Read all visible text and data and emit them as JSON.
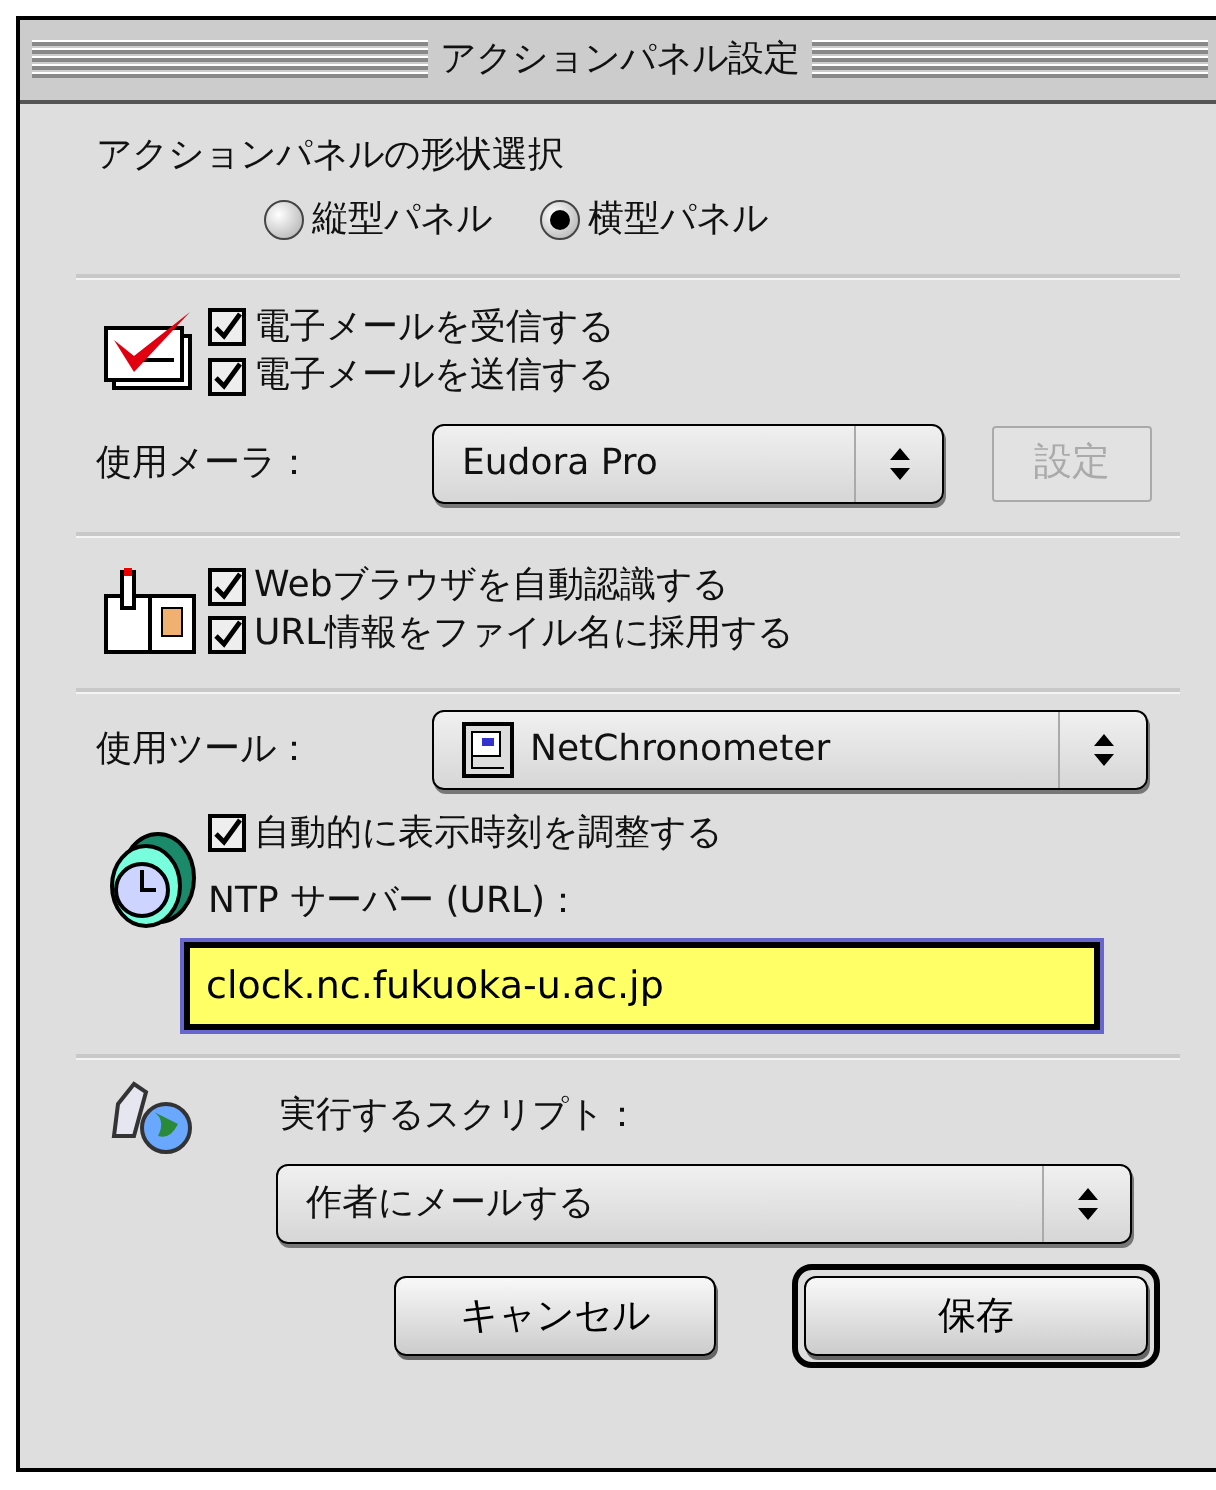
{
  "window": {
    "title": "アクションパネル設定"
  },
  "panel_shape": {
    "label": "アクションパネルの形状選択",
    "options": [
      {
        "label": "縦型パネル",
        "selected": false
      },
      {
        "label": "横型パネル",
        "selected": true
      }
    ]
  },
  "mail": {
    "options": [
      {
        "label": "電子メールを受信する",
        "checked": true
      },
      {
        "label": "電子メールを送信する",
        "checked": true
      }
    ],
    "mailer_label": "使用メーラ：",
    "mailer_value": "Eudora Pro",
    "settings_button": {
      "label": "設定",
      "disabled": true
    }
  },
  "browser": {
    "options": [
      {
        "label": "Webブラウザを自動認識する",
        "checked": true
      },
      {
        "label": "URL情報をファイル名に採用する",
        "checked": true
      }
    ]
  },
  "tool": {
    "label": "使用ツール：",
    "value": "NetChronometer"
  },
  "clock": {
    "option": {
      "label": "自動的に表示時刻を調整する",
      "checked": true
    },
    "ntp_label": "NTP サーバー (URL)：",
    "ntp_value": "clock.nc.fukuoka-u.ac.jp"
  },
  "script": {
    "label": "実行するスクリプト：",
    "value": "作者にメールする"
  },
  "buttons": [
    {
      "label": "キャンセル",
      "default": false
    },
    {
      "label": "保存",
      "default": true
    }
  ]
}
